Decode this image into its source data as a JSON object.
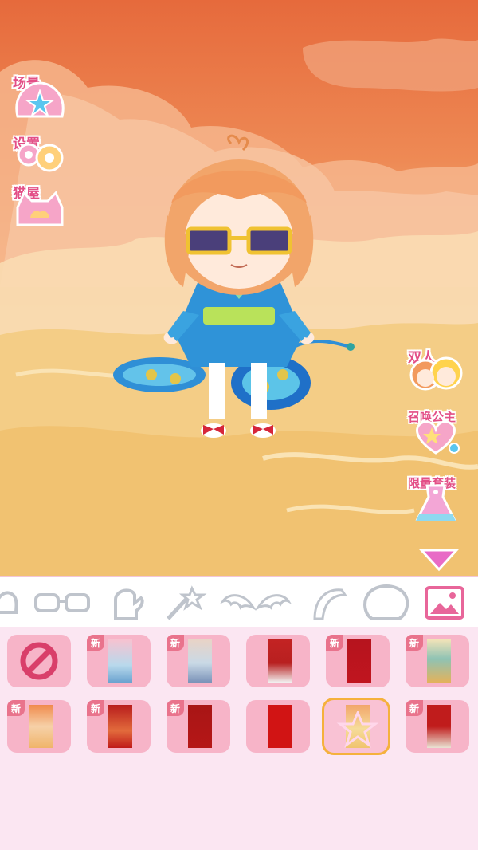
{
  "left_menu": [
    {
      "label": "场景",
      "icon": "star-shell-icon"
    },
    {
      "label": "设置",
      "icon": "gear-icon"
    },
    {
      "label": "猫屋",
      "icon": "cat-house-icon"
    }
  ],
  "right_menu": [
    {
      "label": "双人",
      "icon": "two-dolls-icon"
    },
    {
      "label": "召唤公主",
      "icon": "heart-summon-icon"
    },
    {
      "label": "限量套装",
      "icon": "dress-icon"
    }
  ],
  "toolbar": {
    "tools": [
      "hat-icon",
      "glasses-icon",
      "glove-icon",
      "wand-icon",
      "wings-icon",
      "tail-icon",
      "bubble-icon",
      "background-icon"
    ],
    "active": "background-icon"
  },
  "items": {
    "new_badge": "新",
    "row1": [
      {
        "kind": "none",
        "new": false
      },
      {
        "kind": "blossom",
        "new": true
      },
      {
        "kind": "snow-lake",
        "new": true
      },
      {
        "kind": "red-palace",
        "new": false
      },
      {
        "kind": "red-gold",
        "new": true
      },
      {
        "kind": "gold-mountain",
        "new": true
      }
    ],
    "row2": [
      {
        "kind": "sunset-cloud",
        "new": true
      },
      {
        "kind": "red-sunset",
        "new": true
      },
      {
        "kind": "red-ornament",
        "new": true
      },
      {
        "kind": "plain-red",
        "new": false
      },
      {
        "kind": "golden-sky",
        "new": false,
        "selected": true
      },
      {
        "kind": "red-crane",
        "new": true
      }
    ]
  },
  "colors": {
    "accent": "#e34f87",
    "card": "#f7b4c8",
    "tray": "#fbe6f2",
    "selected": "#f5b13c"
  }
}
